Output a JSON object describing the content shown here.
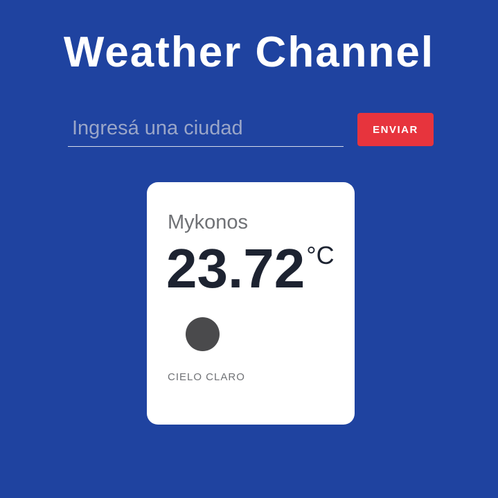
{
  "header": {
    "title": "Weather Channel"
  },
  "search": {
    "placeholder": "Ingresá una ciudad",
    "value": "",
    "submit_label": "ENVIAR"
  },
  "weather_card": {
    "city": "Mykonos",
    "temperature": "23.72",
    "unit": "°C",
    "icon": "weather-condition-icon",
    "description": "CIELO CLARO"
  },
  "colors": {
    "background": "#1f43a0",
    "accent_button": "#e7343d",
    "card_background": "#ffffff"
  }
}
